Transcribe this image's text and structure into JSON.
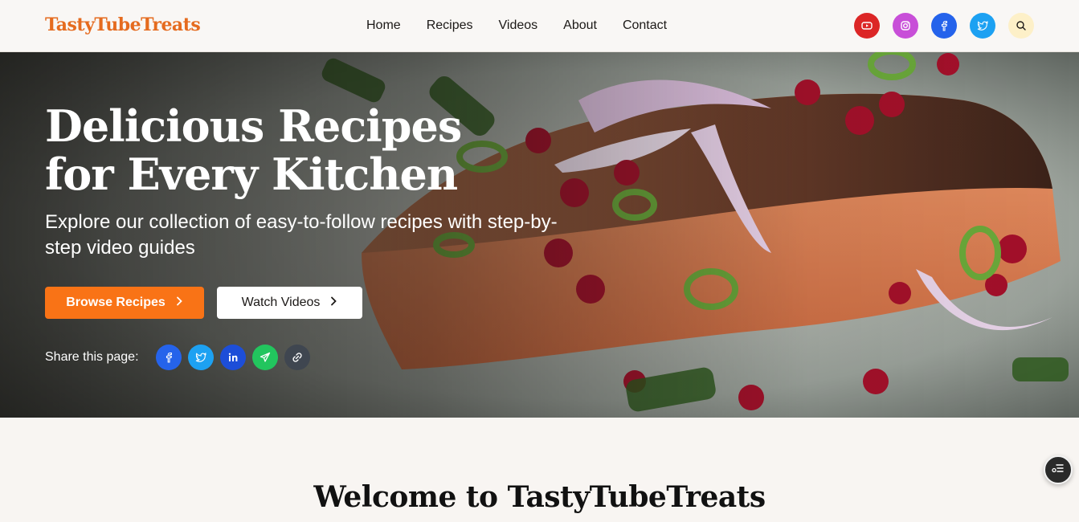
{
  "header": {
    "logo": "TastyTubeTreats",
    "nav": [
      "Home",
      "Recipes",
      "Videos",
      "About",
      "Contact"
    ],
    "socials": [
      {
        "icon": "youtube-icon",
        "color": "#dc2626"
      },
      {
        "icon": "instagram-icon",
        "color": "#c84fd8"
      },
      {
        "icon": "facebook-icon",
        "color": "#2563eb"
      },
      {
        "icon": "twitter-icon",
        "color": "#1da1f2"
      },
      {
        "icon": "search-icon",
        "color": "#fdf0c8"
      }
    ]
  },
  "hero": {
    "title_line1": "Delicious Recipes",
    "title_line2": "for Every Kitchen",
    "subtitle": "Explore our collection of easy-to-follow recipes with step-by-step video guides",
    "primary_button": "Browse Recipes",
    "secondary_button": "Watch Videos",
    "share_label": "Share this page:",
    "share_icons": [
      {
        "icon": "facebook-icon",
        "color": "#2563eb"
      },
      {
        "icon": "twitter-icon",
        "color": "#1da1f2"
      },
      {
        "icon": "linkedin-icon",
        "color": "#1d4ed8"
      },
      {
        "icon": "telegram-icon",
        "color": "#22c55e"
      },
      {
        "icon": "link-icon",
        "color": "#3f4650"
      }
    ]
  },
  "welcome": {
    "title": "Welcome to TastyTubeTreats"
  },
  "colors": {
    "brand": "#f97316",
    "logo": "#e56b1f"
  }
}
